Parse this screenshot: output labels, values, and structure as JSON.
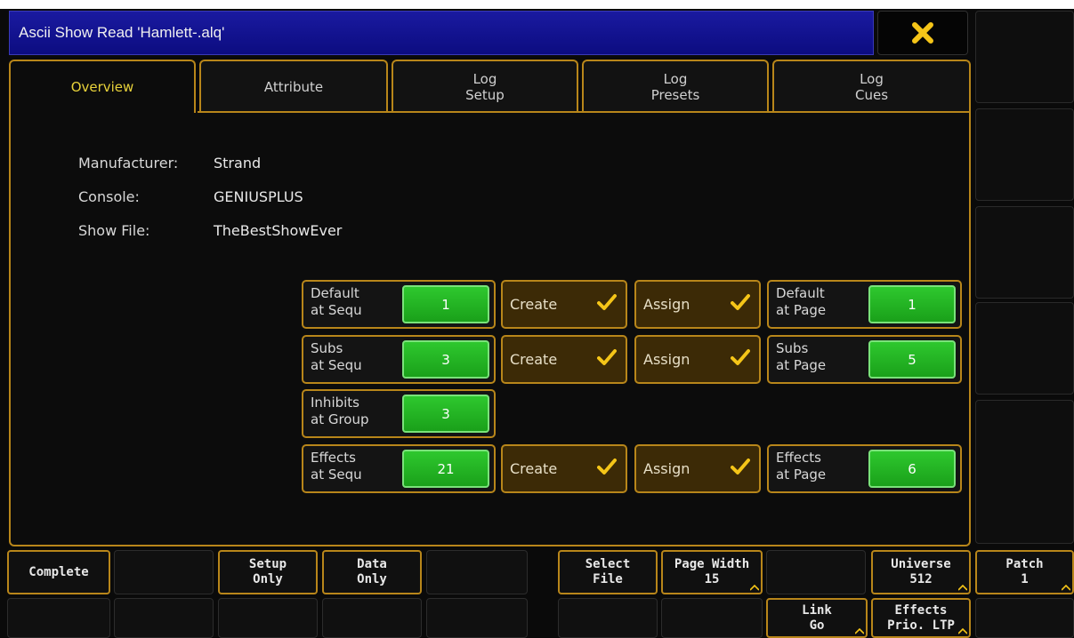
{
  "window": {
    "title": "Ascii Show Read 'Hamlett-.alq'"
  },
  "tabs": [
    {
      "line1": "Overview",
      "line2": ""
    },
    {
      "line1": "Attribute",
      "line2": ""
    },
    {
      "line1": "Log",
      "line2": "Setup"
    },
    {
      "line1": "Log",
      "line2": "Presets"
    },
    {
      "line1": "Log",
      "line2": "Cues"
    }
  ],
  "info": {
    "manufacturer_label": "Manufacturer:",
    "manufacturer_value": "Strand",
    "console_label": "Console:",
    "console_value": "GENIUSPLUS",
    "showfile_label": "Show File:",
    "showfile_value": "TheBestShowEver"
  },
  "rows": {
    "default": {
      "seq_l1": "Default",
      "seq_l2": "at Sequ",
      "seq_value": "1",
      "create": "Create",
      "assign": "Assign",
      "page_l1": "Default",
      "page_l2": "at Page",
      "page_value": "1"
    },
    "subs": {
      "seq_l1": "Subs",
      "seq_l2": "at Sequ",
      "seq_value": "3",
      "create": "Create",
      "assign": "Assign",
      "page_l1": "Subs",
      "page_l2": "at Page",
      "page_value": "5"
    },
    "inhibits": {
      "seq_l1": "Inhibits",
      "seq_l2": "at Group",
      "seq_value": "3"
    },
    "effects": {
      "seq_l1": "Effects",
      "seq_l2": "at Sequ",
      "seq_value": "21",
      "create": "Create",
      "assign": "Assign",
      "page_l1": "Effects",
      "page_l2": "at Page",
      "page_value": "6"
    }
  },
  "bottom": {
    "complete": "Complete",
    "setup_only_l1": "Setup",
    "setup_only_l2": "Only",
    "data_only_l1": "Data",
    "data_only_l2": "Only",
    "select_file_l1": "Select",
    "select_file_l2": "File",
    "page_width_l1": "Page Width",
    "page_width_l2": "15",
    "universe_l1": "Universe",
    "universe_l2": "512",
    "patch_l1": "Patch",
    "patch_l2": "1",
    "link_go_l1": "Link",
    "link_go_l2": "Go",
    "effects_prio_l1": "Effects",
    "effects_prio_l2": "Prio. LTP"
  },
  "colors": {
    "accent": "#b8861a",
    "green": "#22b422",
    "title_bar": "#1414a0",
    "close_icon": "#f5c518"
  },
  "icons": [
    "close-icon",
    "check-icon",
    "corner-arrow-icon"
  ]
}
